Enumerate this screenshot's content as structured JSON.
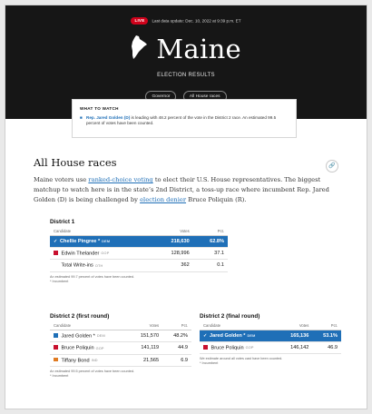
{
  "header": {
    "live_badge": "LIVE",
    "last_update": "Last data update: Dec. 10, 2022 at 9:39 p.m. ET",
    "state": "Maine",
    "subtitle": "ELECTION RESULTS",
    "pills": [
      "Governor",
      "All House races"
    ],
    "colors": {
      "background": "#161616",
      "live": "#d0021b"
    }
  },
  "what_to_watch": {
    "heading": "WHAT TO WATCH",
    "lead_name": "Rep. Jared Golden (D)",
    "text": " is leading with 48.2 percent of the vote in the District 2 race. An estimated 99.5 percent of votes have been counted."
  },
  "section": {
    "title": "All House races",
    "share_icon": "link-icon",
    "intro": {
      "p1": "Maine voters use ",
      "link1": "ranked-choice voting",
      "p2": " to elect their U.S. House representatives. The biggest matchup to watch here is in the state’s 2nd District, a toss-up race where incumbent Rep. Jared Golden (D) is being challenged by ",
      "link2": "election denier",
      "p3": " Bruce Poliquin (R)."
    }
  },
  "colors": {
    "dem": "#1f6fb7",
    "gop": "#c8102e",
    "ind": "#e07b22",
    "oth": "#999999"
  },
  "district1": {
    "title": "District 1",
    "headers": {
      "candidate": "Candidate",
      "votes": "Votes",
      "pct": "Pct."
    },
    "rows": [
      {
        "name": "Chellie Pingree *",
        "party": "DEM",
        "votes": "218,630",
        "pct": "62.8%",
        "winner": true
      },
      {
        "name": "Edwin Thelander",
        "party": "GOP",
        "votes": "128,996",
        "pct": "37.1",
        "winner": false
      },
      {
        "name": "Total Write-ins",
        "party": "OTH",
        "votes": "362",
        "pct": "0.1",
        "winner": false
      }
    ],
    "note1": "An estimated 99.7 percent of votes have been counted.",
    "note2": "* Incumbent"
  },
  "district2_first": {
    "title": "District 2 (first round)",
    "headers": {
      "candidate": "Candidate",
      "votes": "Votes",
      "pct": "Pct."
    },
    "rows": [
      {
        "name": "Jared Golden *",
        "party": "DEM",
        "votes": "151,570",
        "pct": "48.2%",
        "winner": false
      },
      {
        "name": "Bruce Poliquin",
        "party": "GOP",
        "votes": "141,119",
        "pct": "44.9",
        "winner": false
      },
      {
        "name": "Tiffany Bond",
        "party": "IND",
        "votes": "21,565",
        "pct": "6.9",
        "winner": false
      }
    ],
    "note1": "An estimated 99.5 percent of votes have been counted.",
    "note2": "* Incumbent"
  },
  "district2_final": {
    "title": "District 2 (final round)",
    "headers": {
      "candidate": "Candidate",
      "votes": "Votes",
      "pct": "Pct."
    },
    "rows": [
      {
        "name": "Jared Golden *",
        "party": "DEM",
        "votes": "165,136",
        "pct": "53.1%",
        "winner": true
      },
      {
        "name": "Bruce Poliquin",
        "party": "GOP",
        "votes": "146,142",
        "pct": "46.9",
        "winner": false
      }
    ],
    "note1": "We estimate around all votes cast have been counted.",
    "note2": "* Incumbent"
  }
}
